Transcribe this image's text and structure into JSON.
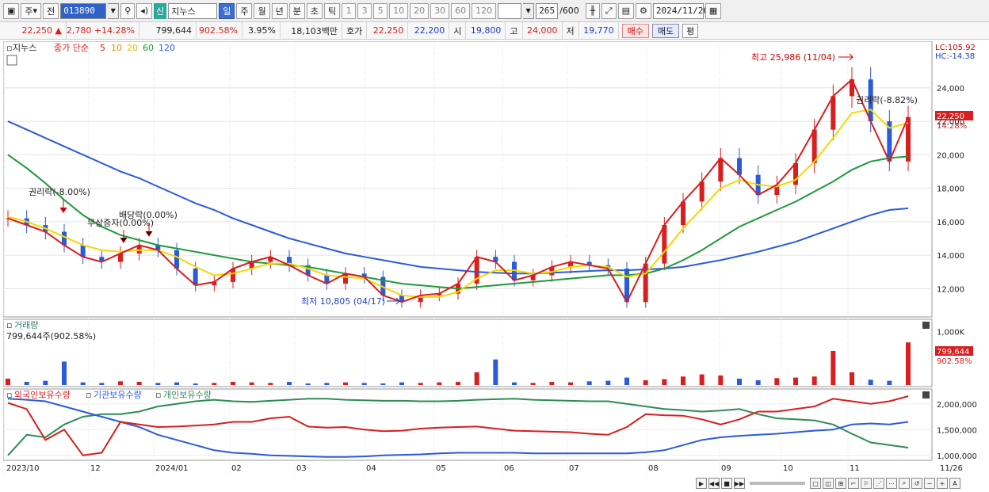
{
  "toolbar": {
    "period_type": "주",
    "prev_label": "전",
    "code": "013890",
    "new_label": "신",
    "stock_name": "지누스",
    "period_buttons": [
      "일",
      "주",
      "월",
      "년",
      "분",
      "초",
      "틱"
    ],
    "interval_buttons": [
      "1",
      "3",
      "5",
      "10",
      "20",
      "30",
      "60",
      "120"
    ],
    "count": "265",
    "count_total": "/600",
    "date": "2024/11/26"
  },
  "quote": {
    "price": "22,250",
    "change": "2,780",
    "change_pct": "+14.28%",
    "volume": "799,644",
    "volume_pct": "902.58%",
    "turnover_pct": "3.95%",
    "amount": "18,103백만",
    "hoga_label": "호가",
    "ask": "22,250",
    "bid": "22,200",
    "open_label": "시",
    "open": "19,800",
    "high_label": "고",
    "high": "24,000",
    "low_label": "저",
    "low": "19,770",
    "buy_label": "매수",
    "sell_label": "매도",
    "eval_label": "평"
  },
  "legend": {
    "stock": "지누스",
    "close_label": "종가 단순",
    "ma": [
      "5",
      "10",
      "20",
      "60",
      "120"
    ],
    "ma_colors": [
      "#d81e1e",
      "#f08a00",
      "#f5d800",
      "#1f9a3a",
      "#2a5bd8"
    ]
  },
  "annotations": {
    "high": "최고 25,986 (11/04)",
    "low": "최저 10,805 (04/17)",
    "rights1": "권리락(-8.00%)",
    "dividend": "배당락(0.00%)",
    "bonus": "무상증자(0.00%)",
    "rights2": "권리락(-8.82%)",
    "lc": "LC:105.92",
    "hc": "HC:-14.38",
    "last_price": "22,250",
    "last_pct": "14.28%",
    "last_volume": "799,644",
    "last_volume_pct": "902.58%"
  },
  "volume_panel": {
    "title": "거래량",
    "readout": "799,644주(902.58%)"
  },
  "holding_panel": {
    "series": [
      "외국인보유수량",
      "기관보유수량",
      "개인보유수량"
    ],
    "colors": [
      "#d81e1e",
      "#2a5bd8",
      "#2e8b57"
    ]
  },
  "chart_data": {
    "type": "line",
    "price_axis": {
      "ticks": [
        "24,000",
        "22,000",
        "20,000",
        "18,000",
        "16,000",
        "14,000",
        "12,000"
      ],
      "values": [
        24000,
        22000,
        20000,
        18000,
        16000,
        14000,
        12000
      ],
      "range": [
        10500,
        26500
      ]
    },
    "volume_axis": {
      "ticks": [
        "1,000K"
      ],
      "values": [
        1000000
      ]
    },
    "holding_axis": {
      "ticks": [
        "2,000,000",
        "1,500,000",
        "1,000,000"
      ],
      "values": [
        2000000,
        1500000,
        1000000
      ]
    },
    "x_ticks": [
      "2023/10",
      "12",
      "2024/01",
      "02",
      "03",
      "04",
      "05",
      "06",
      "07",
      "08",
      "09",
      "10",
      "11",
      "11/26"
    ],
    "close": [
      16200,
      15800,
      15400,
      14600,
      13900,
      13600,
      14100,
      14600,
      14300,
      13200,
      12200,
      12400,
      13200,
      13600,
      13900,
      13400,
      12800,
      12300,
      12900,
      12700,
      11600,
      11200,
      11600,
      11700,
      12300,
      13900,
      13600,
      12500,
      12800,
      13300,
      13600,
      13400,
      13200,
      11200,
      13500,
      15800,
      17200,
      18400,
      19800,
      18800,
      17600,
      18200,
      19500,
      21500,
      23500,
      24500,
      22000,
      19600,
      22250
    ],
    "ma20": [
      16300,
      16000,
      15600,
      15100,
      14600,
      14300,
      14200,
      14300,
      14300,
      13900,
      13300,
      12800,
      12900,
      13200,
      13500,
      13500,
      13200,
      12800,
      12700,
      12600,
      12100,
      11600,
      11500,
      11500,
      11800,
      12600,
      13100,
      13100,
      12900,
      13000,
      13300,
      13400,
      13300,
      12700,
      12900,
      14200,
      15600,
      16800,
      18000,
      18500,
      18200,
      18100,
      18500,
      19600,
      21000,
      22500,
      22700,
      21600,
      21900
    ],
    "ma60": [
      20000,
      19200,
      18300,
      17300,
      16400,
      15700,
      15200,
      14900,
      14600,
      14400,
      14200,
      14000,
      13800,
      13600,
      13500,
      13400,
      13300,
      13100,
      12900,
      12700,
      12500,
      12300,
      12200,
      12100,
      12000,
      12100,
      12200,
      12300,
      12400,
      12500,
      12600,
      12700,
      12800,
      12800,
      12900,
      13200,
      13700,
      14300,
      15000,
      15700,
      16200,
      16700,
      17200,
      17800,
      18400,
      19100,
      19600,
      19800,
      19900
    ],
    "ma120": [
      22000,
      21500,
      21000,
      20500,
      20000,
      19500,
      19000,
      18600,
      18100,
      17600,
      17100,
      16700,
      16200,
      15800,
      15400,
      15000,
      14700,
      14400,
      14100,
      13900,
      13700,
      13500,
      13300,
      13200,
      13100,
      13000,
      12950,
      12900,
      12900,
      12950,
      13000,
      13050,
      13100,
      13100,
      13150,
      13200,
      13300,
      13500,
      13700,
      13950,
      14200,
      14500,
      14800,
      15200,
      15600,
      16000,
      16400,
      16700,
      16800
    ],
    "volume": [
      120000,
      60000,
      80000,
      440000,
      50000,
      40000,
      70000,
      60000,
      40000,
      50000,
      30000,
      40000,
      60000,
      50000,
      40000,
      60000,
      30000,
      40000,
      50000,
      40000,
      30000,
      50000,
      40000,
      50000,
      60000,
      240000,
      480000,
      50000,
      40000,
      60000,
      50000,
      70000,
      80000,
      140000,
      90000,
      110000,
      160000,
      200000,
      180000,
      120000,
      90000,
      130000,
      140000,
      160000,
      640000,
      240000,
      100000,
      80000,
      799644
    ],
    "foreign_holding": [
      2020000,
      1900000,
      1300000,
      1500000,
      1000000,
      1050000,
      1650000,
      1600000,
      1550000,
      1560000,
      1580000,
      1600000,
      1650000,
      1650000,
      1720000,
      1750000,
      1560000,
      1540000,
      1550000,
      1500000,
      1470000,
      1480000,
      1520000,
      1540000,
      1550000,
      1560000,
      1520000,
      1480000,
      1470000,
      1460000,
      1450000,
      1420000,
      1400000,
      1550000,
      1800000,
      1780000,
      1770000,
      1700000,
      1600000,
      1700000,
      1850000,
      1850000,
      1900000,
      1950000,
      2100000,
      2050000,
      2000000,
      2050000,
      2150000
    ],
    "institution_holding": [
      2100000,
      2080000,
      2050000,
      1950000,
      1850000,
      1750000,
      1650000,
      1550000,
      1400000,
      1300000,
      1200000,
      1100000,
      1050000,
      1030000,
      1000000,
      990000,
      980000,
      970000,
      970000,
      980000,
      1000000,
      1010000,
      1020000,
      1040000,
      1050000,
      1050000,
      1050000,
      1050000,
      1040000,
      1040000,
      1040000,
      1040000,
      1040000,
      1040000,
      1060000,
      1100000,
      1200000,
      1300000,
      1350000,
      1380000,
      1400000,
      1420000,
      1450000,
      1480000,
      1500000,
      1600000,
      1620000,
      1600000,
      1650000
    ],
    "individual_holding": [
      1000000,
      1400000,
      1350000,
      1600000,
      1750000,
      1800000,
      1800000,
      1850000,
      1950000,
      2000000,
      2050000,
      2080000,
      2050000,
      2040000,
      2060000,
      2080000,
      2100000,
      2100000,
      2080000,
      2070000,
      2060000,
      2060000,
      2050000,
      2050000,
      2060000,
      2080000,
      2090000,
      2100000,
      2080000,
      2070000,
      2060000,
      2050000,
      2050000,
      2000000,
      1950000,
      1900000,
      1880000,
      1850000,
      1870000,
      1900000,
      1800000,
      1720000,
      1700000,
      1680000,
      1600000,
      1420000,
      1250000,
      1200000,
      1150000
    ]
  }
}
